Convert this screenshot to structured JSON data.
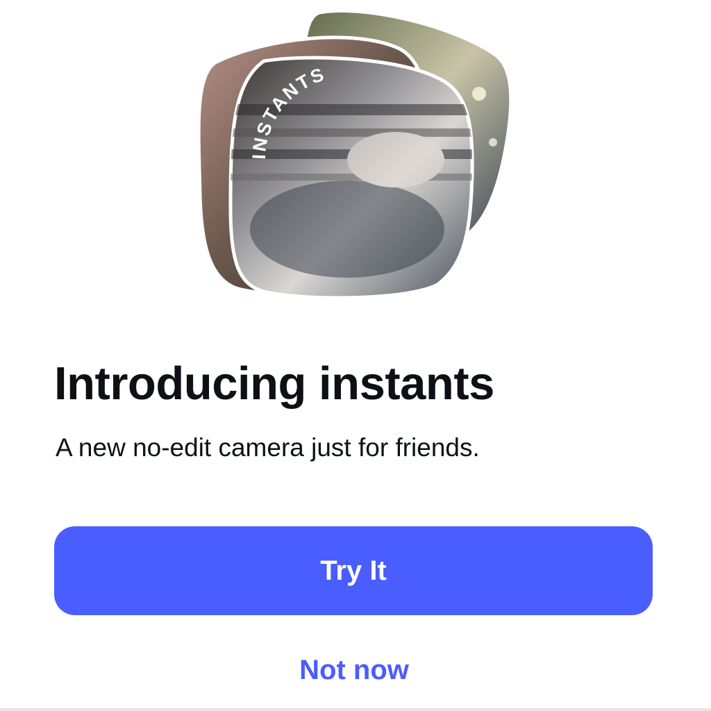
{
  "hero": {
    "badge_text": "INSTANTS",
    "stack_icon": "instants-photo-stack-icon"
  },
  "intro": {
    "title": "Introducing instants",
    "subtitle": "A new no-edit camera just for friends."
  },
  "actions": {
    "primary_label": "Try It",
    "secondary_label": "Not now"
  },
  "colors": {
    "accent": "#4a5dff",
    "text": "#0d1116",
    "background": "#ffffff"
  }
}
